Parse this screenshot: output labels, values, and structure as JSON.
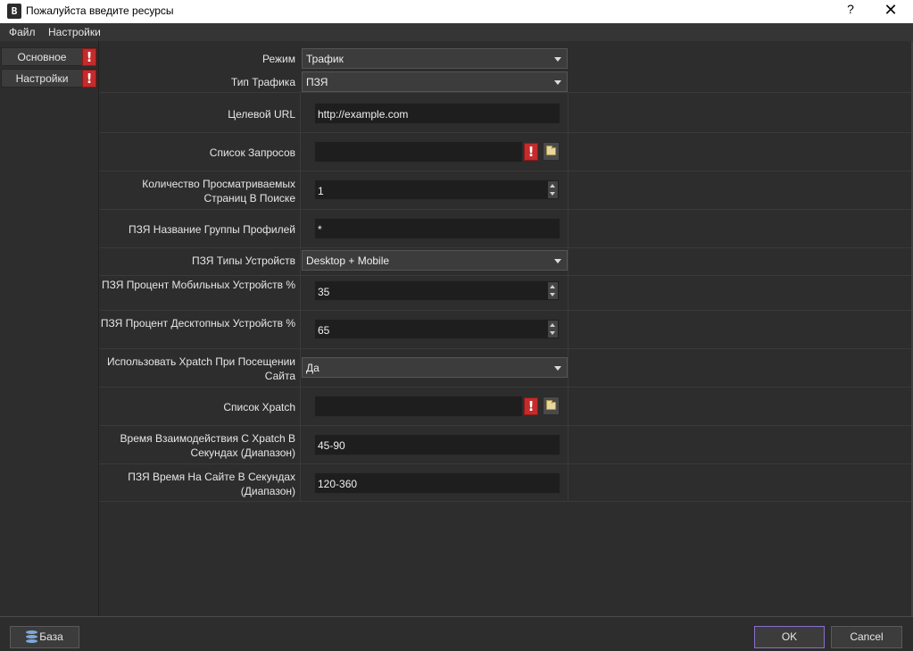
{
  "window": {
    "icon_letter": "B",
    "title": "Пожалуйста введите ресурсы",
    "help_label": "?",
    "close_label": "✕"
  },
  "menu": [
    "Файл",
    "Настройки"
  ],
  "sidebar": {
    "items": [
      {
        "label": "Основное",
        "warning": "!"
      },
      {
        "label": "Настройки",
        "warning": "!"
      }
    ]
  },
  "form": {
    "mode": {
      "label": "Режим",
      "value": "Трафик"
    },
    "traffic_type": {
      "label": "Тип Трафика",
      "value": "ПЗЯ"
    },
    "target_url": {
      "label": "Целевой URL",
      "value": "http://example.com"
    },
    "requests_list": {
      "label": "Список Запросов",
      "value": "",
      "warning": "!"
    },
    "pages_count": {
      "label": "Количество Просматриваемых Страниц В Поиске",
      "value": "1"
    },
    "profile_group": {
      "label": "ПЗЯ Название Группы Профилей",
      "value": "*"
    },
    "device_types": {
      "label": "ПЗЯ Типы Устройств",
      "value": "Desktop + Mobile"
    },
    "mobile_percent": {
      "label": "ПЗЯ Процент Мобильных Устройств %",
      "value": "35"
    },
    "desktop_percent": {
      "label": "ПЗЯ Процент Десктопных Устройств %",
      "value": "65"
    },
    "use_xpatch": {
      "label": "Использовать Xpatch При Посещении Сайта",
      "value": "Да"
    },
    "xpatch_list": {
      "label": "Список Xpatch",
      "value": "",
      "warning": "!"
    },
    "xpatch_time": {
      "label": "Время Взаимодействия С Xpatch В Секундах (Диапазон)",
      "value": "45-90"
    },
    "site_time": {
      "label": "ПЗЯ Время На Сайте В Секундах (Диапазон)",
      "value": "120-360"
    }
  },
  "footer": {
    "base_label": "База",
    "ok_label": "OK",
    "cancel_label": "Cancel"
  },
  "colors": {
    "warning": "#c42b2b",
    "ok_border": "#8a6fc9",
    "background": "#2d2d2d"
  }
}
